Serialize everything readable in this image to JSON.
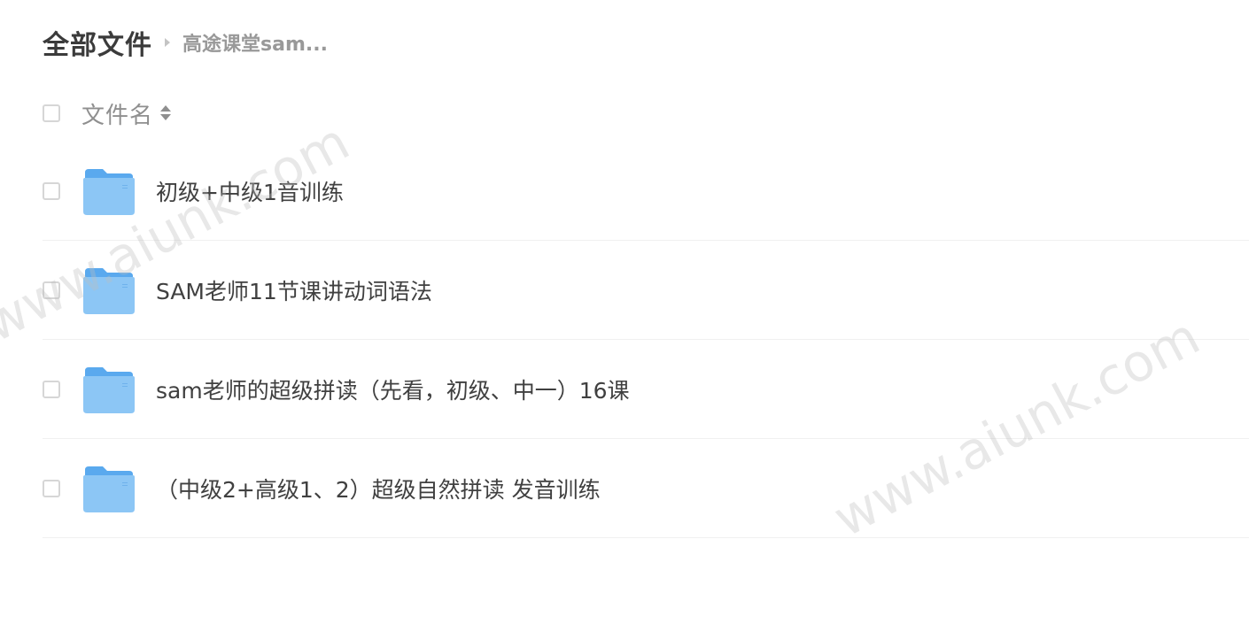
{
  "breadcrumb": {
    "root": "全部文件",
    "current": "高途课堂sam..."
  },
  "header": {
    "column_label": "文件名"
  },
  "files": [
    {
      "name": "初级+中级1音训练",
      "icon": "folder-icon"
    },
    {
      "name": "SAM老师11节课讲动词语法",
      "icon": "folder-icon"
    },
    {
      "name": "sam老师的超级拼读（先看，初级、中一）16课",
      "icon": "folder-icon"
    },
    {
      "name": "（中级2+高级1、2）超级自然拼读 发音训练",
      "icon": "folder-icon"
    }
  ],
  "watermark": {
    "text": "www.aiunk.com"
  },
  "colors": {
    "folder_back": "#5aa9ee",
    "folder_front": "#8cc6f5",
    "row_border": "#f0f0f0",
    "checkbox_border": "#d6d6d6"
  }
}
